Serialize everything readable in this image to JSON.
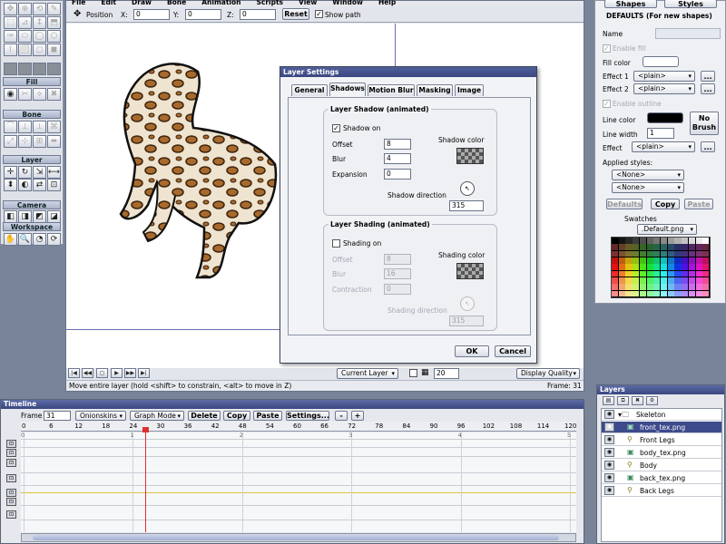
{
  "menu": [
    "File",
    "Edit",
    "Draw",
    "Bone",
    "Animation",
    "Scripts",
    "View",
    "Window",
    "Help"
  ],
  "toolbar": {
    "position_label": "Position",
    "x_label": "X:",
    "x_value": "0",
    "y_label": "Y:",
    "y_value": "0",
    "z_label": "Z:",
    "z_value": "0",
    "reset_label": "Reset",
    "show_path_label": "Show path"
  },
  "tools_panel": {
    "fill_header": "Fill",
    "bone_header": "Bone",
    "layer_header": "Layer",
    "camera_header": "Camera",
    "workspace_header": "Workspace"
  },
  "style_panel": {
    "shapes_btn": "Shapes",
    "styles_btn": "Styles",
    "defaults_title": "DEFAULTS (For new shapes)",
    "name_label": "Name",
    "enable_fill": "Enable fill",
    "fill_color_label": "Fill color",
    "effect1_label": "Effect 1",
    "effect1_value": "<plain>",
    "effect2_label": "Effect 2",
    "effect2_value": "<plain>",
    "enable_outline": "Enable outline",
    "line_color_label": "Line color",
    "line_width_label": "Line width",
    "line_width_value": "1",
    "effect_label": "Effect",
    "effect_value": "<plain>",
    "no_brush_label": "No Brush",
    "applied_styles_label": "Applied styles:",
    "style1_value": "<None>",
    "style2_value": "<None>",
    "defaults_btn": "Defaults",
    "copy_btn": "Copy",
    "paste_btn": "Paste",
    "swatches_label": "Swatches",
    "swatch_file": ".Default.png",
    "ellipsis": "..."
  },
  "dialog": {
    "title": "Layer Settings",
    "tabs": [
      "General",
      "Shadows",
      "Motion Blur",
      "Masking",
      "Image"
    ],
    "active_tab": "Shadows",
    "shadow_group": "Layer Shadow (animated)",
    "shadow_on": "Shadow on",
    "offset_label": "Offset",
    "offset_value": "8",
    "blur_label": "Blur",
    "blur_value": "4",
    "expansion_label": "Expansion",
    "expansion_value": "0",
    "shadow_color_label": "Shadow color",
    "shadow_direction_label": "Shadow direction",
    "shadow_direction_value": "315",
    "shading_group": "Layer Shading (animated)",
    "shading_on": "Shading on",
    "s_offset_label": "Offset",
    "s_offset_value": "8",
    "s_blur_label": "Blur",
    "s_blur_value": "16",
    "contraction_label": "Contraction",
    "contraction_value": "0",
    "shading_color_label": "Shading color",
    "shading_direction_label": "Shading direction",
    "shading_direction_value": "315",
    "ok": "OK",
    "cancel": "Cancel"
  },
  "canvas_bar": {
    "current_layer": "Current Layer",
    "zoom_value": "20",
    "display_quality": "Display Quality",
    "status_text": "Move entire layer (hold <shift> to constrain, <alt> to move in Z)",
    "frame_text": "Frame: 31"
  },
  "timeline": {
    "title": "Timeline",
    "frame_label": "Frame",
    "frame_value": "31",
    "onionskins": "Onionskins",
    "graph_mode": "Graph Mode",
    "delete": "Delete",
    "copy": "Copy",
    "paste": "Paste",
    "settings": "Settings...",
    "minus": "-",
    "plus": "+",
    "ruler_ticks": [
      "0",
      "6",
      "12",
      "18",
      "24",
      "30",
      "36",
      "42",
      "48",
      "54",
      "60",
      "66",
      "72",
      "78",
      "84",
      "90",
      "96",
      "102",
      "108",
      "114",
      "120"
    ],
    "second_marks": [
      "0",
      "1",
      "2",
      "3",
      "4",
      "5"
    ]
  },
  "layers": {
    "title": "Layers",
    "items": [
      {
        "name": "Skeleton",
        "type": "group"
      },
      {
        "name": "front_tex.png",
        "type": "image",
        "selected": true
      },
      {
        "name": "Front Legs",
        "type": "bone"
      },
      {
        "name": "body_tex.png",
        "type": "image"
      },
      {
        "name": "Body",
        "type": "bone"
      },
      {
        "name": "back_tex.png",
        "type": "image"
      },
      {
        "name": "Back Legs",
        "type": "bone"
      }
    ]
  },
  "colors": {
    "accent": "#3f4f8c",
    "selected_layer": "#3d4a8c",
    "canvas_line": "#6a6fb0",
    "playhead": "#e03030"
  }
}
